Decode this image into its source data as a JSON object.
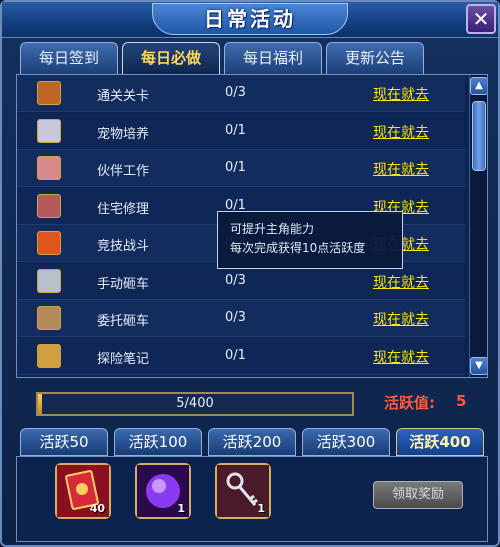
{
  "window": {
    "title": "日常活动"
  },
  "tabs": [
    {
      "label": "每日签到",
      "active": false
    },
    {
      "label": "每日必做",
      "active": true
    },
    {
      "label": "每日福利",
      "active": false
    },
    {
      "label": "更新公告",
      "active": false
    }
  ],
  "tasks": [
    {
      "name": "通关关卡",
      "progress": "0/3",
      "link": "现在就去",
      "icon": "stage-clear-icon",
      "color": "#c0652a"
    },
    {
      "name": "宠物培养",
      "progress": "0/1",
      "link": "现在就去",
      "icon": "pet-icon",
      "color": "#c8c8d8"
    },
    {
      "name": "伙伴工作",
      "progress": "0/1",
      "link": "现在就去",
      "icon": "partner-icon",
      "color": "#d88a8a"
    },
    {
      "name": "住宅修理",
      "progress": "0/1",
      "link": "现在就去",
      "icon": "house-repair-icon",
      "color": "#b45a5a"
    },
    {
      "name": "竞技战斗",
      "progress": "0/3",
      "link": "现在就去",
      "icon": "arena-fire-icon",
      "color": "#e0541e"
    },
    {
      "name": "手动砸车",
      "progress": "0/3",
      "link": "现在就去",
      "icon": "car-smash-icon",
      "color": "#b8c0cc"
    },
    {
      "name": "委托砸车",
      "progress": "0/3",
      "link": "现在就去",
      "icon": "delegate-smash-icon",
      "color": "#b48a5a"
    },
    {
      "name": "探险笔记",
      "progress": "0/1",
      "link": "现在就去",
      "icon": "adventure-note-icon",
      "color": "#d0a040"
    }
  ],
  "tooltip": {
    "line1": "可提升主角能力",
    "line2": "每次完成获得10点活跃度"
  },
  "activity": {
    "progress_text": "5/400",
    "fraction": 0.0125,
    "label": "活跃值:",
    "value": "5"
  },
  "level_tabs": [
    {
      "label": "活跃50",
      "active": false
    },
    {
      "label": "活跃100",
      "active": false
    },
    {
      "label": "活跃200",
      "active": false
    },
    {
      "label": "活跃300",
      "active": false
    },
    {
      "label": "活跃400",
      "active": true
    }
  ],
  "rewards": [
    {
      "icon": "red-ticket-icon",
      "count": "40",
      "color": "#c8202a"
    },
    {
      "icon": "purple-orb-icon",
      "count": "1",
      "color": "#7a2ad0"
    },
    {
      "icon": "silver-key-icon",
      "count": "1",
      "color": "#5a2a3a"
    }
  ],
  "claim_button": {
    "label": "领取奖励"
  }
}
